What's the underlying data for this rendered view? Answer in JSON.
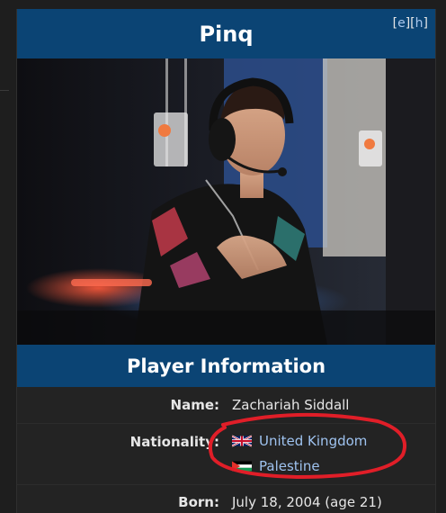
{
  "infobox": {
    "title": "Pinq",
    "edit_links": {
      "open": "[",
      "edit": "e",
      "sep": "][",
      "history": "h",
      "close": "]"
    },
    "section_title": "Player Information",
    "fields": {
      "name": {
        "label": "Name:",
        "value": "Zachariah Siddall"
      },
      "nationality": {
        "label": "Nationality:",
        "items": [
          {
            "country": "United Kingdom",
            "flag_icon": "uk-flag-icon"
          },
          {
            "country": "Palestine",
            "flag_icon": "palestine-flag-icon"
          }
        ]
      },
      "born": {
        "label": "Born:",
        "value": "July 18, 2004 (age 21)"
      }
    }
  },
  "colors": {
    "header_bar": "#0b4474",
    "page_bg": "#1e1e1e",
    "link": "#9fc3f0",
    "annotation": "#e01e28"
  }
}
